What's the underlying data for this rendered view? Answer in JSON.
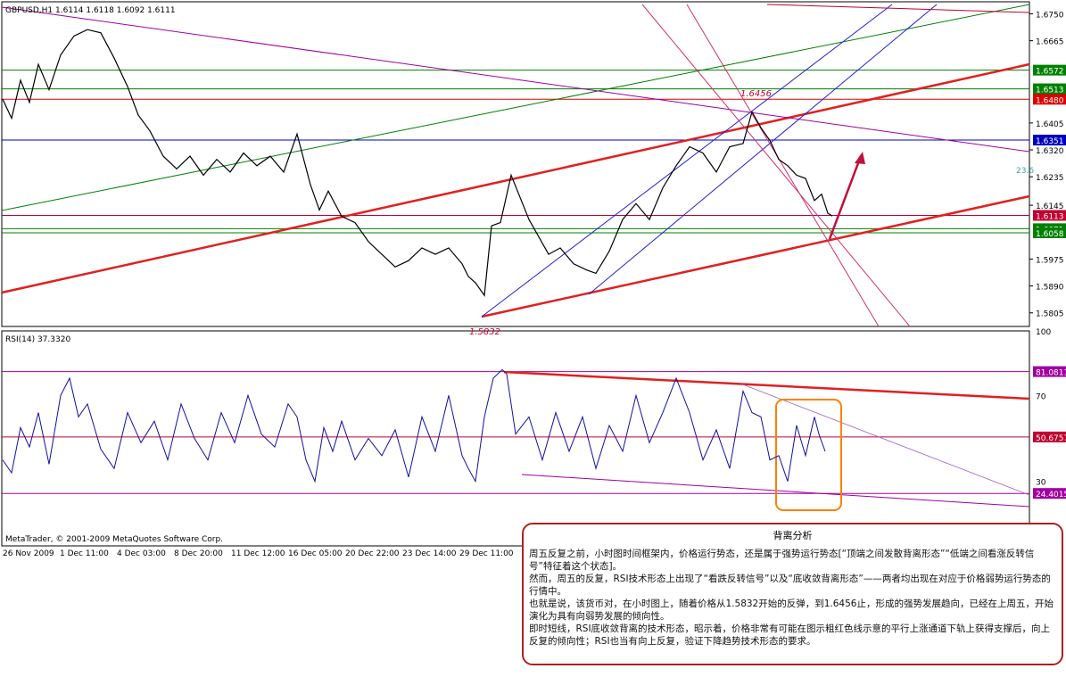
{
  "chart_data": [
    {
      "type": "line",
      "title": "GBPUSD,H1  1.6114 1.6118 1.6092 1.6111",
      "ylim": [
        1.5762,
        1.6788
      ],
      "y_ticks": [
        "1.6750",
        "1.6665",
        "1.6572",
        "1.6513",
        "1.6480",
        "1.6405",
        "1.6351",
        "1.6320",
        "1.6235",
        "1.6145",
        "1.6113",
        "1.6058",
        "1.5975",
        "1.5890",
        "1.5805"
      ],
      "x_ticks": [
        "26 Nov 2009",
        "1 Dec 11:00",
        "4 Dec 03:00",
        "8 Dec 20:00",
        "11 Dec 12:00",
        "16 Dec 05:00",
        "20 Dec 22:00",
        "23 Dec 14:00",
        "29 Dec 11:00"
      ],
      "price_levels": [
        {
          "label": "1.6572",
          "value": 1.6572,
          "color": "#008000"
        },
        {
          "label": "1.6513",
          "value": 1.6513,
          "color": "#008000"
        },
        {
          "label": "1.6480",
          "value": 1.648,
          "color": "#dd0000"
        },
        {
          "label": "1.6351",
          "value": 1.6351,
          "color": "#0000c0"
        },
        {
          "label": "1.6113",
          "value": 1.6113,
          "color": "#c00030"
        },
        {
          "label": "1.6071",
          "value": 1.6071,
          "color": "#008000"
        },
        {
          "label": "1.6058",
          "value": 1.6058,
          "color": "#008000"
        }
      ],
      "annotations": {
        "high": "1.6456",
        "low": "1.5832",
        "fib": "23.6"
      },
      "series": [
        {
          "x": [
            0,
            10,
            20,
            30,
            40,
            52,
            65,
            80,
            95,
            110,
            125,
            140,
            152,
            165,
            180,
            195,
            210,
            225,
            240,
            255,
            270,
            285,
            300,
            315,
            330,
            345,
            355,
            365,
            380,
            395,
            410,
            425,
            440,
            455,
            470,
            485,
            500,
            515,
            522,
            530,
            540,
            548,
            558,
            570,
            580,
            590,
            600,
            612,
            625,
            640,
            655,
            665,
            680,
            695,
            710,
            725,
            740,
            755,
            770,
            785,
            800,
            815,
            830,
            840,
            850,
            860,
            870,
            880,
            890,
            900,
            910,
            918,
            925,
            930
          ],
          "values": [
            1.648,
            1.642,
            1.654,
            1.647,
            1.659,
            1.651,
            1.662,
            1.668,
            1.67,
            1.669,
            1.661,
            1.652,
            1.643,
            1.638,
            1.63,
            1.626,
            1.63,
            1.624,
            1.629,
            1.625,
            1.631,
            1.627,
            1.63,
            1.625,
            1.637,
            1.621,
            1.613,
            1.619,
            1.611,
            1.609,
            1.603,
            1.599,
            1.595,
            1.597,
            1.601,
            1.599,
            1.601,
            1.596,
            1.592,
            1.59,
            1.586,
            1.608,
            1.609,
            1.624,
            1.617,
            1.61,
            1.605,
            1.599,
            1.601,
            1.596,
            1.594,
            1.593,
            1.6,
            1.61,
            1.615,
            1.61,
            1.62,
            1.627,
            1.633,
            1.631,
            1.625,
            1.633,
            1.634,
            1.644,
            1.639,
            1.635,
            1.629,
            1.627,
            1.624,
            1.623,
            1.616,
            1.618,
            1.612,
            1.6111
          ]
        }
      ]
    },
    {
      "type": "line",
      "title": "RSI(14) 37.3320",
      "ylim": [
        0,
        100
      ],
      "y_ticks": [
        "100",
        "81.0811",
        "70",
        "50.6757",
        "30",
        "24.4015"
      ],
      "levels": [
        {
          "label": "81.0811",
          "value": 81.0811,
          "color": "#a000a0"
        },
        {
          "label": "50.6757",
          "value": 50.6757,
          "color": "#c00030"
        },
        {
          "label": "24.4015",
          "value": 24.4015,
          "color": "#a000a0"
        }
      ],
      "series": [
        {
          "x": [
            0,
            10,
            20,
            30,
            40,
            52,
            65,
            75,
            85,
            95,
            110,
            125,
            140,
            155,
            170,
            185,
            200,
            215,
            230,
            245,
            260,
            275,
            290,
            305,
            320,
            330,
            340,
            350,
            360,
            370,
            380,
            395,
            410,
            425,
            440,
            455,
            470,
            485,
            500,
            515,
            522,
            530,
            540,
            550,
            560,
            565,
            575,
            590,
            605,
            620,
            635,
            650,
            665,
            680,
            695,
            710,
            725,
            740,
            755,
            770,
            785,
            800,
            815,
            830,
            840,
            850,
            860,
            870,
            880,
            890,
            900,
            910,
            915,
            922
          ],
          "values": [
            40,
            34,
            55,
            46,
            62,
            38,
            70,
            78,
            60,
            66,
            45,
            36,
            62,
            48,
            58,
            40,
            66,
            50,
            40,
            62,
            48,
            70,
            52,
            46,
            66,
            60,
            40,
            30,
            55,
            44,
            58,
            40,
            50,
            42,
            54,
            32,
            60,
            44,
            70,
            42,
            36,
            30,
            60,
            78,
            82,
            80,
            52,
            60,
            40,
            62,
            44,
            60,
            36,
            56,
            44,
            70,
            48,
            62,
            78,
            62,
            40,
            54,
            36,
            72,
            62,
            60,
            40,
            42,
            30,
            56,
            42,
            60,
            52,
            44
          ]
        }
      ]
    }
  ],
  "footer": {
    "copyright": "MetaTrader, © 2001-2009 MetaQuotes Software Corp."
  },
  "note": {
    "title": "背离分析",
    "paragraphs": [
      "周五反复之前，小时图时间框架内，价格运行势态，还是属于强势运行势态[“顶端之间发散背离形态”“低端之间看涨反转信号”特征着这个状态]。",
      "然而，周五的反复，RSI技术形态上出现了“看跌反转信号”以及“底收敛背离形态”——两者均出现在对应于价格弱势运行势态的行情中。",
      "也就是说，该货币对，在小时图上，随着价格从1.5832开始的反弹，到1.6456止，形成的强势发展趋向，已经在上周五，开始演化为具有向弱势发展的倾向性。",
      "即时短线，RSI底收敛背离的技术形态，昭示着，价格非常有可能在图示粗红色线示意的平行上涨通道下轨上获得支撑后，向上反复的倾向性；RSI也当有向上反复，验证下降趋势技术形态的要求。"
    ]
  }
}
